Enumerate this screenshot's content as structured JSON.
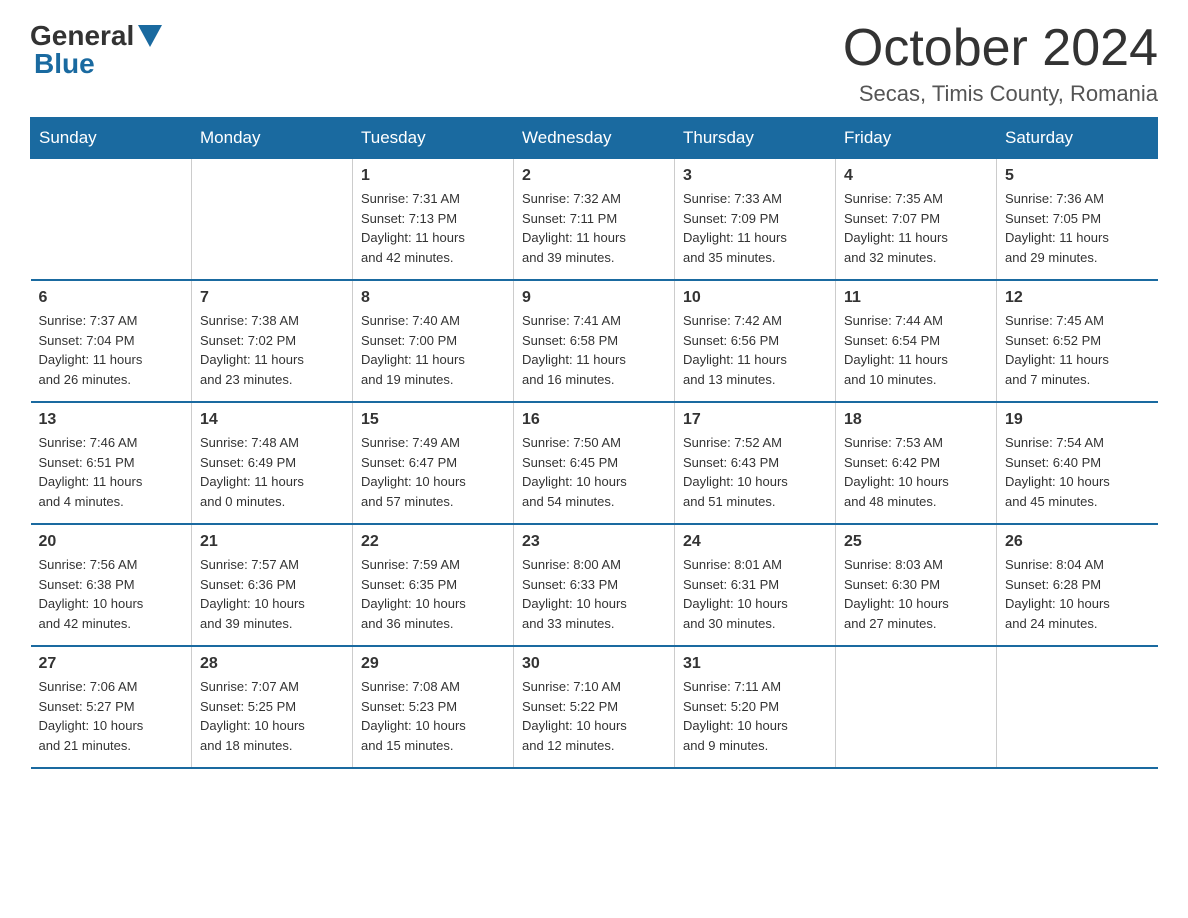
{
  "logo": {
    "general": "General",
    "blue": "Blue"
  },
  "title": {
    "month": "October 2024",
    "location": "Secas, Timis County, Romania"
  },
  "weekdays": [
    "Sunday",
    "Monday",
    "Tuesday",
    "Wednesday",
    "Thursday",
    "Friday",
    "Saturday"
  ],
  "weeks": [
    [
      {
        "day": "",
        "info": ""
      },
      {
        "day": "",
        "info": ""
      },
      {
        "day": "1",
        "info": "Sunrise: 7:31 AM\nSunset: 7:13 PM\nDaylight: 11 hours\nand 42 minutes."
      },
      {
        "day": "2",
        "info": "Sunrise: 7:32 AM\nSunset: 7:11 PM\nDaylight: 11 hours\nand 39 minutes."
      },
      {
        "day": "3",
        "info": "Sunrise: 7:33 AM\nSunset: 7:09 PM\nDaylight: 11 hours\nand 35 minutes."
      },
      {
        "day": "4",
        "info": "Sunrise: 7:35 AM\nSunset: 7:07 PM\nDaylight: 11 hours\nand 32 minutes."
      },
      {
        "day": "5",
        "info": "Sunrise: 7:36 AM\nSunset: 7:05 PM\nDaylight: 11 hours\nand 29 minutes."
      }
    ],
    [
      {
        "day": "6",
        "info": "Sunrise: 7:37 AM\nSunset: 7:04 PM\nDaylight: 11 hours\nand 26 minutes."
      },
      {
        "day": "7",
        "info": "Sunrise: 7:38 AM\nSunset: 7:02 PM\nDaylight: 11 hours\nand 23 minutes."
      },
      {
        "day": "8",
        "info": "Sunrise: 7:40 AM\nSunset: 7:00 PM\nDaylight: 11 hours\nand 19 minutes."
      },
      {
        "day": "9",
        "info": "Sunrise: 7:41 AM\nSunset: 6:58 PM\nDaylight: 11 hours\nand 16 minutes."
      },
      {
        "day": "10",
        "info": "Sunrise: 7:42 AM\nSunset: 6:56 PM\nDaylight: 11 hours\nand 13 minutes."
      },
      {
        "day": "11",
        "info": "Sunrise: 7:44 AM\nSunset: 6:54 PM\nDaylight: 11 hours\nand 10 minutes."
      },
      {
        "day": "12",
        "info": "Sunrise: 7:45 AM\nSunset: 6:52 PM\nDaylight: 11 hours\nand 7 minutes."
      }
    ],
    [
      {
        "day": "13",
        "info": "Sunrise: 7:46 AM\nSunset: 6:51 PM\nDaylight: 11 hours\nand 4 minutes."
      },
      {
        "day": "14",
        "info": "Sunrise: 7:48 AM\nSunset: 6:49 PM\nDaylight: 11 hours\nand 0 minutes."
      },
      {
        "day": "15",
        "info": "Sunrise: 7:49 AM\nSunset: 6:47 PM\nDaylight: 10 hours\nand 57 minutes."
      },
      {
        "day": "16",
        "info": "Sunrise: 7:50 AM\nSunset: 6:45 PM\nDaylight: 10 hours\nand 54 minutes."
      },
      {
        "day": "17",
        "info": "Sunrise: 7:52 AM\nSunset: 6:43 PM\nDaylight: 10 hours\nand 51 minutes."
      },
      {
        "day": "18",
        "info": "Sunrise: 7:53 AM\nSunset: 6:42 PM\nDaylight: 10 hours\nand 48 minutes."
      },
      {
        "day": "19",
        "info": "Sunrise: 7:54 AM\nSunset: 6:40 PM\nDaylight: 10 hours\nand 45 minutes."
      }
    ],
    [
      {
        "day": "20",
        "info": "Sunrise: 7:56 AM\nSunset: 6:38 PM\nDaylight: 10 hours\nand 42 minutes."
      },
      {
        "day": "21",
        "info": "Sunrise: 7:57 AM\nSunset: 6:36 PM\nDaylight: 10 hours\nand 39 minutes."
      },
      {
        "day": "22",
        "info": "Sunrise: 7:59 AM\nSunset: 6:35 PM\nDaylight: 10 hours\nand 36 minutes."
      },
      {
        "day": "23",
        "info": "Sunrise: 8:00 AM\nSunset: 6:33 PM\nDaylight: 10 hours\nand 33 minutes."
      },
      {
        "day": "24",
        "info": "Sunrise: 8:01 AM\nSunset: 6:31 PM\nDaylight: 10 hours\nand 30 minutes."
      },
      {
        "day": "25",
        "info": "Sunrise: 8:03 AM\nSunset: 6:30 PM\nDaylight: 10 hours\nand 27 minutes."
      },
      {
        "day": "26",
        "info": "Sunrise: 8:04 AM\nSunset: 6:28 PM\nDaylight: 10 hours\nand 24 minutes."
      }
    ],
    [
      {
        "day": "27",
        "info": "Sunrise: 7:06 AM\nSunset: 5:27 PM\nDaylight: 10 hours\nand 21 minutes."
      },
      {
        "day": "28",
        "info": "Sunrise: 7:07 AM\nSunset: 5:25 PM\nDaylight: 10 hours\nand 18 minutes."
      },
      {
        "day": "29",
        "info": "Sunrise: 7:08 AM\nSunset: 5:23 PM\nDaylight: 10 hours\nand 15 minutes."
      },
      {
        "day": "30",
        "info": "Sunrise: 7:10 AM\nSunset: 5:22 PM\nDaylight: 10 hours\nand 12 minutes."
      },
      {
        "day": "31",
        "info": "Sunrise: 7:11 AM\nSunset: 5:20 PM\nDaylight: 10 hours\nand 9 minutes."
      },
      {
        "day": "",
        "info": ""
      },
      {
        "day": "",
        "info": ""
      }
    ]
  ]
}
